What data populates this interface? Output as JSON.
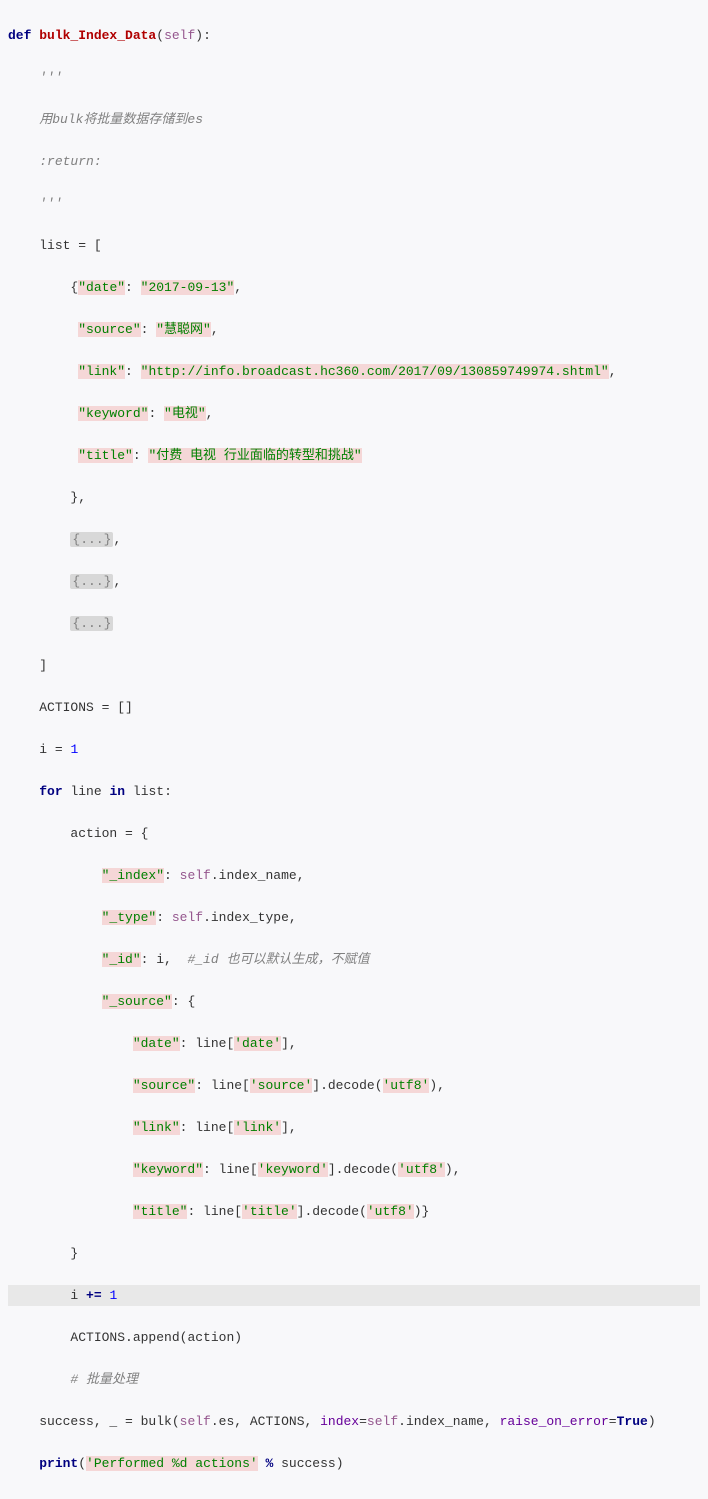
{
  "code": {
    "def_kw": "def",
    "func_name": "bulk_Index_Data",
    "self_param": "self",
    "docstring_open": "'''",
    "docstring_l1": "用bulk将批量数据存储到es",
    "docstring_l2": ":return:",
    "docstring_close": "'''",
    "list_assign": "list = [",
    "dict_open": "{",
    "date_key": "\"date\"",
    "date_val": "\"2017-09-13\"",
    "source_key": "\"source\"",
    "source_val": "\"慧聪网\"",
    "link_key": "\"link\"",
    "link_val": "\"http://info.broadcast.hc360.com/2017/09/130859749974.shtml\"",
    "keyword_key": "\"keyword\"",
    "keyword_val": "\"电视\"",
    "title_key": "\"title\"",
    "title_val": "\"付费 电视 行业面临的转型和挑战\"",
    "dict_close": "},",
    "fold1": "{...}",
    "fold2": "{...}",
    "fold3": "{...}",
    "list_close": "]",
    "actions_assign": "ACTIONS = []",
    "i_assign_pre": "i = ",
    "i_assign_val": "1",
    "for_kw": "for",
    "line_var": "line",
    "in_kw": "in",
    "list_var": "list:",
    "action_assign": "action = {",
    "idx_key": "\"_index\"",
    "self_kw": "self",
    "idx_attr": ".index_name,",
    "type_key": "\"_type\"",
    "type_attr": ".index_type,",
    "id_key": "\"_id\"",
    "id_val": ": i,  ",
    "id_comment": "#_id 也可以默认生成，不赋值",
    "src_key": "\"_source\"",
    "src_open": ": {",
    "s_date_key": "\"date\"",
    "s_date_rhs_pre": ": line[",
    "s_date_arg": "'date'",
    "s_date_rhs_post": "],",
    "s_source_key": "\"source\"",
    "s_source_pre": ": line[",
    "s_source_arg": "'source'",
    "s_source_mid": "].decode(",
    "s_utf8_1": "'utf8'",
    "s_source_post": "),",
    "s_link_key": "\"link\"",
    "s_link_pre": ": line[",
    "s_link_arg": "'link'",
    "s_link_post": "],",
    "s_keyword_key": "\"keyword\"",
    "s_keyword_pre": ": line[",
    "s_keyword_arg": "'keyword'",
    "s_keyword_mid": "].decode(",
    "s_utf8_2": "'utf8'",
    "s_keyword_post": "),",
    "s_title_key": "\"title\"",
    "s_title_pre": ": line[",
    "s_title_arg": "'title'",
    "s_title_mid": "].decode(",
    "s_utf8_3": "'utf8'",
    "s_title_post": ")}",
    "action_close": "}",
    "i_incr_pre": "i ",
    "i_incr_op": "+=",
    "i_incr_val": " 1",
    "actions_append": "ACTIONS.append(action)",
    "batch_comment": "# 批量处理",
    "bulk_pre": "success, _ = bulk(",
    "bulk_self": "self",
    "bulk_es": ".es, ACTIONS, ",
    "bulk_index_kw": "index",
    "bulk_eq": "=",
    "bulk_self2": "self",
    "bulk_idxname": ".index_name, ",
    "bulk_raise_kw": "raise_on_error",
    "bulk_eq2": "=",
    "bulk_true": "True",
    "bulk_close": ")",
    "print_kw": "print",
    "print_open": "(",
    "print_str": "'Performed %d actions'",
    "print_pct": " % ",
    "print_var": "success)",
    "colon": ":",
    "comma": ","
  }
}
